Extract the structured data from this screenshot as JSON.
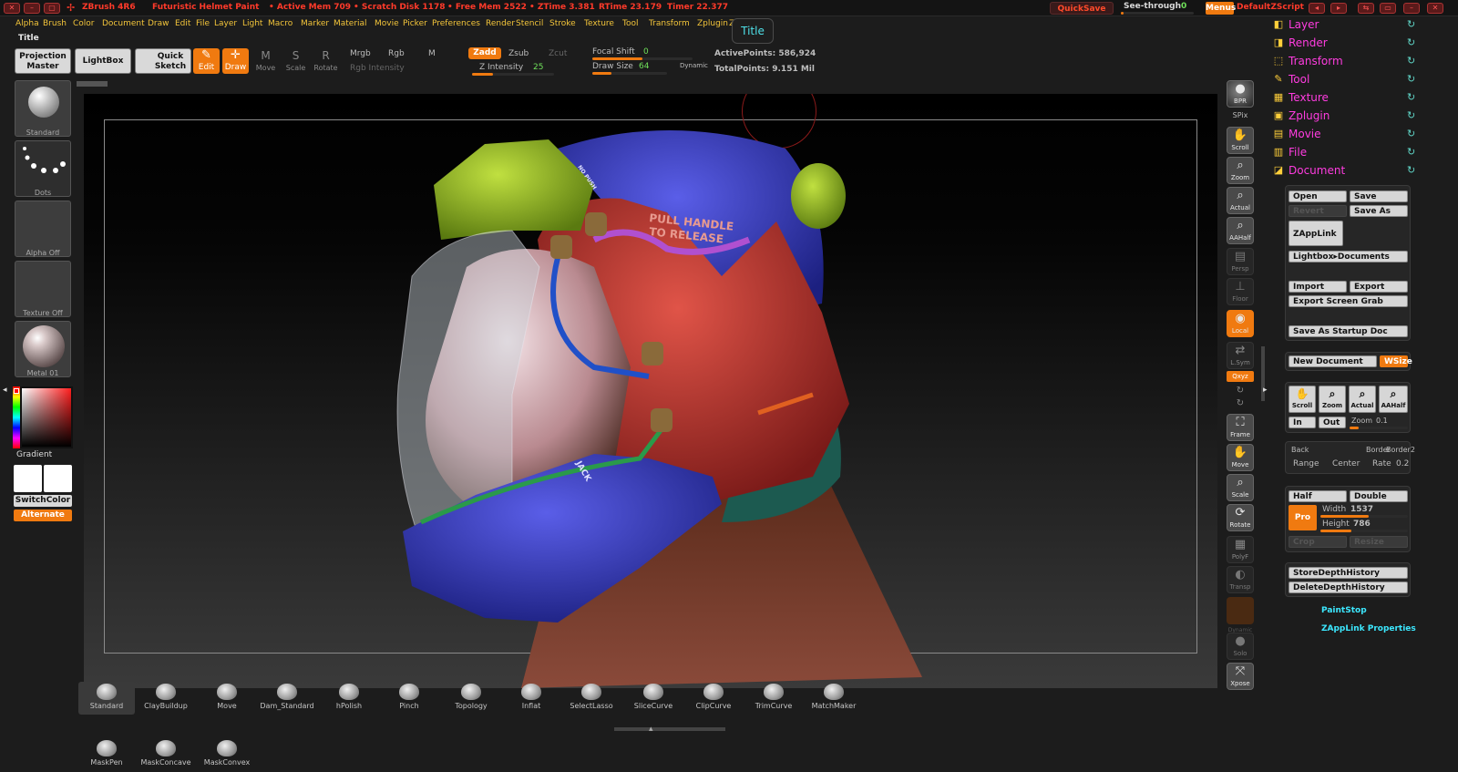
{
  "titlebar": {
    "app": "ZBrush 4R6",
    "doc": "Futuristic Helmet Paint",
    "active_mem": "• Active Mem 709",
    "scratch": "• Scratch Disk 1178",
    "free_mem": "• Free Mem 2522",
    "ztime": "• ZTime 3.381",
    "rtime": "RTime 23.179",
    "timer": "Timer 22.377",
    "quicksave": "QuickSave",
    "see_through": "See-through",
    "see_through_val": "0",
    "menus": "Menus",
    "script": "DefaultZScript"
  },
  "menu": [
    "Alpha",
    "Brush",
    "Color",
    "Document",
    "Draw",
    "Edit",
    "File",
    "Layer",
    "Light",
    "Macro",
    "Marker",
    "Material",
    "Movie",
    "Picker",
    "Preferences",
    "Render",
    "Stencil",
    "Stroke",
    "Texture",
    "Tool",
    "Transform",
    "Zplugin",
    "Zscript"
  ],
  "tooltip": "Title",
  "title_label": "Title",
  "toolbar": {
    "projection": "Projection",
    "master": "Master",
    "lightbox": "LightBox",
    "quick": "Quick",
    "sketch": "Sketch",
    "edit": "Edit",
    "draw": "Draw",
    "move": "Move",
    "scale": "Scale",
    "rotate": "Rotate",
    "mrgb": "Mrgb",
    "rgb": "Rgb",
    "m": "M",
    "rgb_intensity": "Rgb Intensity",
    "zadd": "Zadd",
    "zsub": "Zsub",
    "zcut": "Zcut",
    "z_intensity": "Z Intensity",
    "z_intensity_val": "25",
    "focal_shift": "Focal Shift",
    "focal_shift_val": "0",
    "draw_size": "Draw Size",
    "draw_size_val": "64",
    "dynamic": "Dynamic",
    "active_points": "ActivePoints: 586,924",
    "total_points": "TotalPoints: 9.151 Mil"
  },
  "left_shelf": {
    "items": [
      "Standard",
      "Dots",
      "Alpha Off",
      "Texture Off",
      "Metal 01"
    ],
    "gradient": "Gradient",
    "switchcolor": "SwitchColor",
    "alternate": "Alternate"
  },
  "right_shelf": {
    "bpr": "BPR",
    "spix": "SPix",
    "buttons": [
      "Scroll",
      "Zoom",
      "Actual",
      "AAHalf",
      "Persp",
      "Floor",
      "Local",
      "L.Sym",
      "Frame",
      "Move",
      "Scale",
      "Rotate",
      "PolyF",
      "Transp",
      "Solo",
      "Xpose"
    ],
    "xyz": "Qxyz",
    "dynamic": "Dynamic"
  },
  "palettes": {
    "items": [
      {
        "label": "Layer",
        "icon": "◧"
      },
      {
        "label": "Render",
        "icon": "◨"
      },
      {
        "label": "Transform",
        "icon": "⬚"
      },
      {
        "label": "Tool",
        "icon": "✎"
      },
      {
        "label": "Texture",
        "icon": "▦"
      },
      {
        "label": "Zplugin",
        "icon": "▣"
      },
      {
        "label": "Movie",
        "icon": "▤"
      },
      {
        "label": "File",
        "icon": "▥"
      },
      {
        "label": "Document",
        "icon": "◪"
      }
    ],
    "refresh_icon": "↻"
  },
  "document": {
    "open": "Open",
    "save": "Save",
    "revert": "Revert",
    "save_as": "Save As",
    "zapplink": "ZAppLink",
    "lightbox_docs": "Lightbox▸Documents",
    "import": "Import",
    "export": "Export",
    "export_grab": "Export Screen Grab",
    "save_startup": "Save As Startup Doc",
    "new_doc": "New Document",
    "wsize": "WSize",
    "scroll": "Scroll",
    "zoom": "Zoom",
    "actual": "Actual",
    "aahalf": "AAHalf",
    "in": "In",
    "out": "Out",
    "zoom_label": "Zoom",
    "zoom_val": "0.1",
    "back": "Back",
    "border": "Border",
    "border2": "Border2",
    "range": "Range",
    "center": "Center",
    "rate": "Rate",
    "rate_val": "0.2",
    "half": "Half",
    "double": "Double",
    "pro": "Pro",
    "width": "Width",
    "width_val": "1537",
    "height": "Height",
    "height_val": "786",
    "crop": "Crop",
    "resize": "Resize",
    "store_depth": "StoreDepthHistory",
    "delete_depth": "DeleteDepthHistory",
    "paintstop": "PaintStop",
    "zapplink_props": "ZAppLink Properties"
  },
  "canvas": {
    "label1": "PULL HANDLE",
    "label2": "TO RELEASE",
    "jack": "JACK",
    "no_push": "NO PUSH"
  },
  "bottom_shelf": {
    "brushes": [
      "Standard",
      "ClayBuildup",
      "Move",
      "Dam_Standard",
      "hPolish",
      "Pinch",
      "Topology",
      "Inflat",
      "SelectLasso",
      "SliceCurve",
      "ClipCurve",
      "TrimCurve",
      "MatchMaker"
    ],
    "masks": [
      "MaskPen",
      "MaskConcave",
      "MaskConvex"
    ]
  }
}
